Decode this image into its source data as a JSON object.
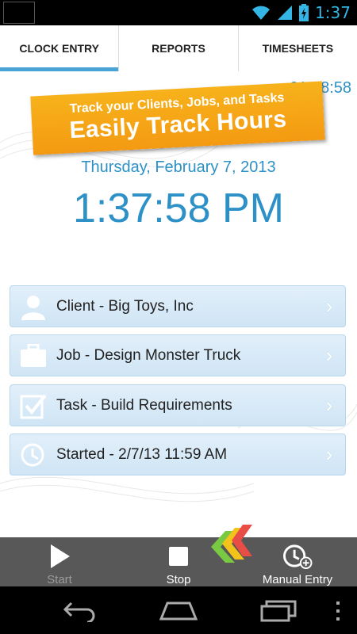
{
  "status": {
    "time": "1:37"
  },
  "tabs": [
    {
      "label": "CLOCK ENTRY",
      "active": true
    },
    {
      "label": "REPORTS",
      "active": false
    },
    {
      "label": "TIMESHEETS",
      "active": false
    }
  ],
  "timer": "01:38:58",
  "banner": {
    "line1": "Track your Clients, Jobs, and Tasks",
    "line2": "Easily Track Hours"
  },
  "date": "Thursday, February 7, 2013",
  "time": "1:37:58 PM",
  "rows": [
    {
      "icon": "person-icon",
      "label": "Client - Big Toys, Inc"
    },
    {
      "icon": "briefcase-icon",
      "label": "Job - Design Monster Truck"
    },
    {
      "icon": "checklist-icon",
      "label": "Task - Build Requirements"
    },
    {
      "icon": "clock-icon",
      "label": "Started - 2/7/13 11:59 AM"
    }
  ],
  "actions": {
    "start": "Start",
    "stop": "Stop",
    "manual": "Manual Entry"
  },
  "colors": {
    "accent": "#2d91c7",
    "banner": "#f49a12",
    "tab_indicator": "#4aa3d6",
    "action_bar": "#585858"
  }
}
